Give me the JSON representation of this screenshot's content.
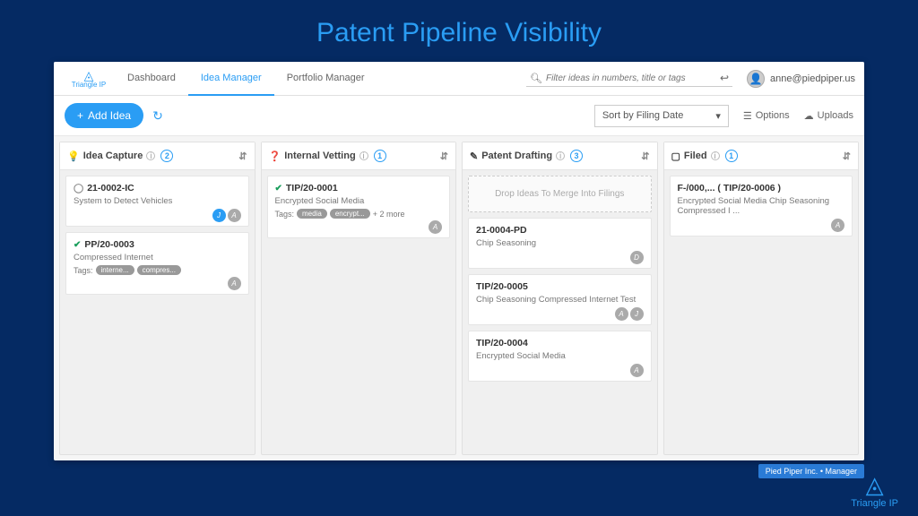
{
  "page": {
    "title": "Patent Pipeline Visibility",
    "brand": "Triangle IP",
    "footer_badge": "Pied Piper Inc. • Manager"
  },
  "nav": {
    "dashboard": "Dashboard",
    "idea_manager": "Idea Manager",
    "portfolio_manager": "Portfolio Manager"
  },
  "search": {
    "placeholder": "Filter ideas in numbers, title or tags"
  },
  "user": {
    "email": "anne@piedpiper.us"
  },
  "toolbar": {
    "add": "Add Idea",
    "sort": "Sort by Filing Date",
    "options": "Options",
    "uploads": "Uploads"
  },
  "columns": [
    {
      "icon": "bulb",
      "title": "Idea Capture",
      "count": 2,
      "cards": [
        {
          "status": "open",
          "id": "21-0002-IC",
          "subtitle": "System to Detect Vehicles",
          "tags": [],
          "tag_more": "",
          "avatars": [
            "J",
            "A"
          ],
          "avatar_colors": [
            "blue",
            ""
          ]
        },
        {
          "status": "check",
          "id": "PP/20-0003",
          "subtitle": "Compressed Internet",
          "tags": [
            "interne...",
            "compres..."
          ],
          "tag_more": "",
          "avatars": [
            "A"
          ],
          "avatar_colors": [
            ""
          ]
        }
      ]
    },
    {
      "icon": "question",
      "title": "Internal Vetting",
      "count": 1,
      "cards": [
        {
          "status": "check",
          "id": "TIP/20-0001",
          "subtitle": "Encrypted Social Media",
          "tags": [
            "media",
            "encrypt..."
          ],
          "tag_more": "+ 2 more",
          "avatars": [
            "A"
          ],
          "avatar_colors": [
            ""
          ]
        }
      ]
    },
    {
      "icon": "edit",
      "title": "Patent Drafting",
      "count": 3,
      "dropzone": "Drop Ideas To Merge Into Filings",
      "cards": [
        {
          "status": "",
          "id": "21-0004-PD",
          "subtitle": "Chip Seasoning",
          "tags": [],
          "tag_more": "",
          "avatars": [
            "D"
          ],
          "avatar_colors": [
            ""
          ]
        },
        {
          "status": "",
          "id": "TIP/20-0005",
          "subtitle": "Chip Seasoning Compressed Internet Test",
          "tags": [],
          "tag_more": "",
          "avatars": [
            "A",
            "J"
          ],
          "avatar_colors": [
            "",
            ""
          ]
        },
        {
          "status": "",
          "id": "TIP/20-0004",
          "subtitle": "Encrypted Social Media",
          "tags": [],
          "tag_more": "",
          "avatars": [
            "A"
          ],
          "avatar_colors": [
            ""
          ]
        }
      ]
    },
    {
      "icon": "box",
      "title": "Filed",
      "count": 1,
      "cards": [
        {
          "status": "",
          "id": "F-/000,...  ( TIP/20-0006 )",
          "subtitle": "Encrypted Social Media Chip Seasoning Compressed I ...",
          "tags": [],
          "tag_more": "",
          "avatars": [
            "A"
          ],
          "avatar_colors": [
            ""
          ]
        }
      ]
    }
  ]
}
